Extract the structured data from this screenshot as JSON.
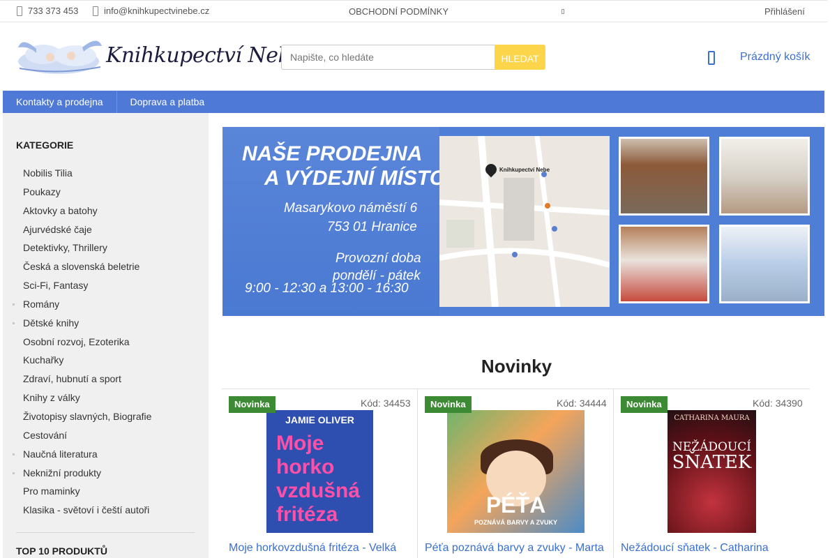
{
  "topbar": {
    "phone": "733 373 453",
    "email": "info@knihkupectvinebe.cz",
    "terms": "OBCHODNÍ PODMÍNKY",
    "login": "Přihlášení"
  },
  "header": {
    "logo_text": "Knihkupectví Nebe",
    "search_placeholder": "Napište, co hledáte",
    "search_button": "HLEDAT",
    "cart_label": "Prázdný košík"
  },
  "nav": {
    "items": [
      {
        "label": "Kontakty a prodejna"
      },
      {
        "label": "Doprava a platba"
      }
    ]
  },
  "sidebar": {
    "categories_title": "KATEGORIE",
    "categories": [
      {
        "label": "Nobilis Tilia",
        "has_children": false
      },
      {
        "label": "Poukazy",
        "has_children": false
      },
      {
        "label": "Aktovky a batohy",
        "has_children": false
      },
      {
        "label": "Ajurvédské čaje",
        "has_children": false
      },
      {
        "label": "Detektivky, Thrillery",
        "has_children": false
      },
      {
        "label": "Česká a slovenská beletrie",
        "has_children": false
      },
      {
        "label": "Sci-Fi, Fantasy",
        "has_children": false
      },
      {
        "label": "Romány",
        "has_children": true
      },
      {
        "label": "Dětské knihy",
        "has_children": true
      },
      {
        "label": "Osobní rozvoj, Ezoterika",
        "has_children": false
      },
      {
        "label": "Kuchařky",
        "has_children": false
      },
      {
        "label": "Zdraví, hubnutí a sport",
        "has_children": false
      },
      {
        "label": "Knihy z války",
        "has_children": false
      },
      {
        "label": "Životopisy slavných, Biografie",
        "has_children": false
      },
      {
        "label": "Cestování",
        "has_children": false
      },
      {
        "label": "Naučná literatura",
        "has_children": true
      },
      {
        "label": "Neknižní produkty",
        "has_children": true
      },
      {
        "label": "Pro maminky",
        "has_children": false
      },
      {
        "label": "Klasika - světoví i čeští autoři",
        "has_children": false
      }
    ],
    "top_title": "TOP 10 PRODUKTŮ"
  },
  "banner": {
    "title_line1": "NAŠE PRODEJNA",
    "title_line2": "A VÝDEJNÍ MÍSTO",
    "address_line1": "Masarykovo náměstí 6",
    "address_line2": "753 01 Hranice",
    "hours_line1": "Provozní doba",
    "hours_line2": "pondělí - pátek",
    "hours_line3": "9:00 - 12:30 a 13:00 - 16:30",
    "map_pin_label": "Knihkupectví Nebe"
  },
  "novinky": {
    "title": "Novinky",
    "products": [
      {
        "badge": "Novinka",
        "code": "Kód: 34453",
        "name": "Moje horkovzdušná fritéza - Velká",
        "cover_author": "JAMIE OLIVER",
        "cover_title_1": "Moje",
        "cover_title_2": "horko",
        "cover_title_3": "vzdušná",
        "cover_title_4": "fritéza"
      },
      {
        "badge": "Novinka",
        "code": "Kód: 34444",
        "name": "Péťa poznává barvy a zvuky - Marta",
        "cover_title": "PÉŤA",
        "cover_subtitle": "POZNÁVÁ BARVY A ZVUKY"
      },
      {
        "badge": "Novinka",
        "code": "Kód: 34390",
        "name": "Nežádoucí sňatek - Catharina",
        "cover_author": "CATHARINA MAURA",
        "cover_title_1": "NEŽÁDOUCÍ",
        "cover_title_2": "SŇATEK"
      }
    ]
  },
  "colors": {
    "nav_blue": "#4e79d6",
    "link_blue": "#3a6fd0",
    "search_button": "#fdd54a",
    "badge_green": "#3c8a33",
    "sidebar_bg": "#f0f0f0"
  }
}
